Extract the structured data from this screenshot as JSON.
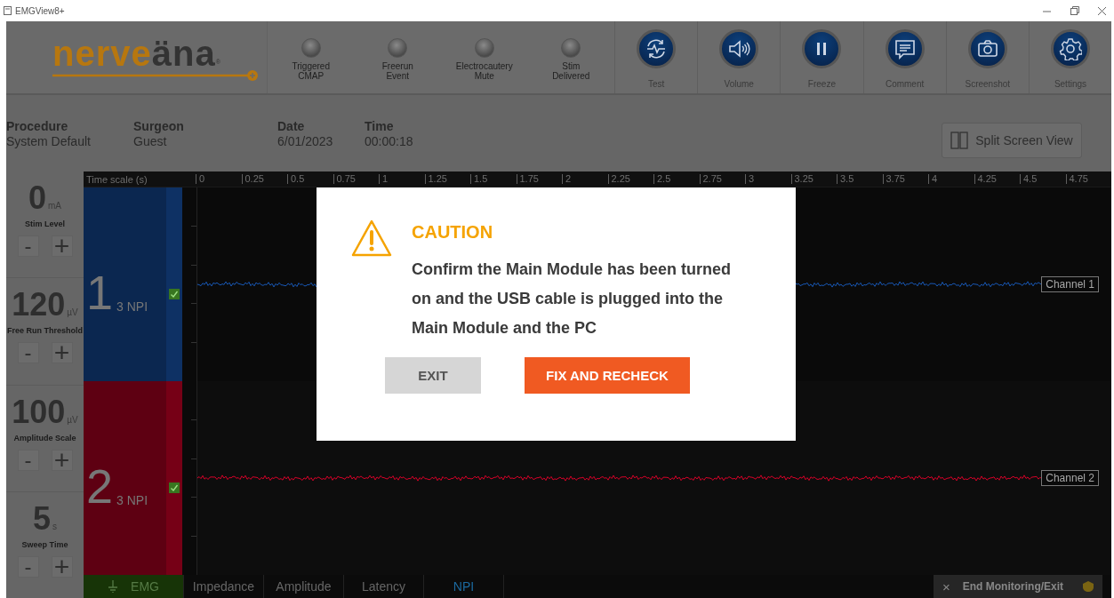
{
  "window": {
    "title": "EMGView8+"
  },
  "header": {
    "logo": "nerveäna",
    "logo_mark": "®",
    "indicators": [
      {
        "label": "Triggered\nCMAP",
        "lit": false
      },
      {
        "label": "Freerun\nEvent",
        "lit": false
      },
      {
        "label": "Electrocautery\nMute",
        "lit": false
      },
      {
        "label": "Stim\nDelivered",
        "lit": false
      }
    ],
    "toolbar": [
      {
        "label": "Test"
      },
      {
        "label": "Volume"
      },
      {
        "label": "Freeze"
      },
      {
        "label": "Comment"
      },
      {
        "label": "Screenshot"
      },
      {
        "label": "Settings"
      }
    ]
  },
  "info": {
    "fields": [
      {
        "label": "Procedure",
        "value": "System Default"
      },
      {
        "label": "Surgeon",
        "value": "Guest"
      },
      {
        "label": "Date",
        "value": "6/01/2023"
      },
      {
        "label": "Time",
        "value": "00:00:18"
      }
    ],
    "split_button": "Split Screen View"
  },
  "controls": [
    {
      "value": "0",
      "unit": "mA",
      "label": "Stim Level",
      "minus": "-",
      "plus": "+"
    },
    {
      "value": "120",
      "unit": "µV",
      "label": "Free Run Threshold",
      "minus": "-",
      "plus": "+"
    },
    {
      "value": "100",
      "unit": "µV",
      "label": "Amplitude Scale",
      "minus": "-",
      "plus": "+"
    },
    {
      "value": "5",
      "unit": "s",
      "label": "Sweep Time",
      "minus": "-",
      "plus": "+"
    }
  ],
  "plot": {
    "time_scale_label": "Time scale (s)",
    "ticks": [
      "0",
      "0.25",
      "0.5",
      "0.75",
      "1",
      "1.25",
      "1.5",
      "1.75",
      "2",
      "2.25",
      "2.5",
      "2.75",
      "3",
      "3.25",
      "3.5",
      "3.75",
      "4",
      "4.25",
      "4.5",
      "4.75"
    ]
  },
  "channels": [
    {
      "number": "1",
      "name": "3 NPI",
      "checked": true,
      "color": "#0b2750",
      "tag": "Channel 1"
    },
    {
      "number": "2",
      "name": "3 NPI",
      "checked": true,
      "color": "#5e0012",
      "tag": "Channel 2"
    }
  ],
  "tabs": [
    {
      "label": "EMG",
      "selected": true,
      "highlighted": false
    },
    {
      "label": "Impedance",
      "selected": false,
      "highlighted": false
    },
    {
      "label": "Amplitude",
      "selected": false,
      "highlighted": false
    },
    {
      "label": "Latency",
      "selected": false,
      "highlighted": false
    },
    {
      "label": "NPI",
      "selected": false,
      "highlighted": true
    }
  ],
  "exit_button": {
    "close": "×",
    "label": "End Monitoring/Exit"
  },
  "dialog": {
    "title": "CAUTION",
    "message": "Confirm the Main Module has been turned on and the USB cable is plugged into the Main Module and the PC",
    "buttons": [
      {
        "label": "EXIT",
        "kind": "secondary"
      },
      {
        "label": "FIX AND RECHECK",
        "kind": "primary"
      }
    ]
  }
}
